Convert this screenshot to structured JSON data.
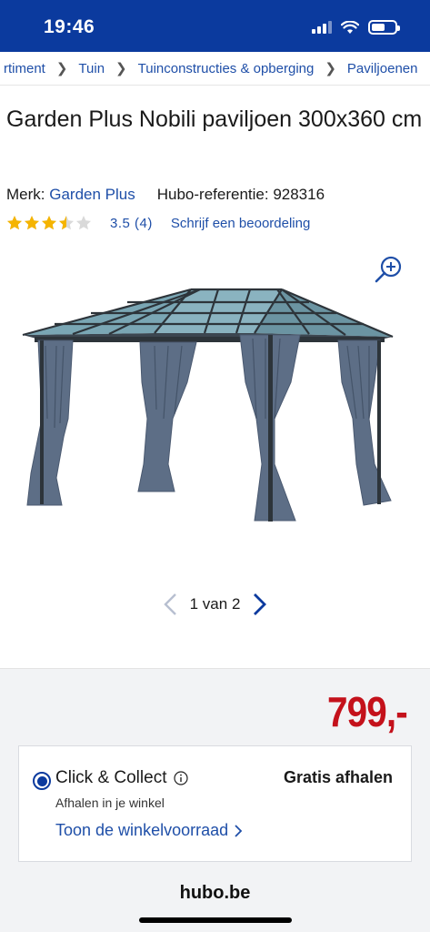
{
  "status_bar": {
    "time": "19:46",
    "battery_level": 0.6
  },
  "breadcrumb": [
    {
      "label": "rtiment"
    },
    {
      "label": "Tuin"
    },
    {
      "label": "Tuinconstructies & opberging"
    },
    {
      "label": "Paviljoenen"
    }
  ],
  "product": {
    "title": "Garden Plus Nobili paviljoen 300x360 cm",
    "brand_label": "Merk:",
    "brand": "Garden Plus",
    "ref_label": "Hubo-referentie:",
    "ref": "928316",
    "rating": 3.5,
    "rating_text": "3.5",
    "review_count": "(4)",
    "review_link": "Schrijf een beoordeling",
    "image_name": "gazebo-image"
  },
  "gallery": {
    "current": "1",
    "of_label": "van",
    "total": "2"
  },
  "purchase": {
    "price": "799,-",
    "option_title": "Click & Collect",
    "option_price": "Gratis afhalen",
    "option_sub": "Afhalen in je winkel",
    "stock_link": "Toon de winkelvoorraad"
  },
  "footer": {
    "domain": "hubo.be"
  },
  "colors": {
    "brand_blue": "#0b3a9e",
    "link_blue": "#1f4fa8",
    "price_red": "#c4111b",
    "star_gold": "#f5b400"
  }
}
